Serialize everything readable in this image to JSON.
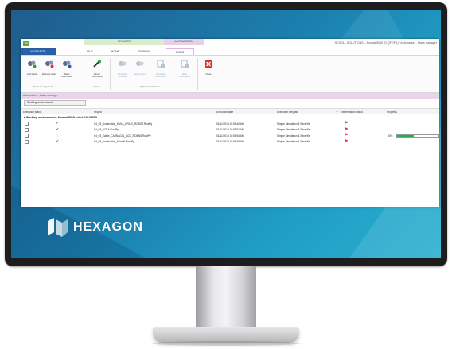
{
  "window": {
    "app_badge": "NC",
    "title": "HCSOLL SOLUTIONS – Nomad 5019 (D:QFOFS) / Automation - Tasks manager",
    "context_project": "PROJECT",
    "context_automation": "AUTOMATION"
  },
  "tabs": {
    "file": "WORKSITE",
    "t1": "FILE",
    "t2": "HOME",
    "t3": "DISPLAY",
    "t4": "ROBO"
  },
  "ribbon": {
    "add_tasks": "Add tasks",
    "remove_tasks": "Remove tasks",
    "tasks_information": "Tasks information",
    "tasks_group": "Tasks management",
    "server_information": "Server information",
    "server_group": "Server",
    "previous_process": "Previous process",
    "next_process": "Next process",
    "previous_information": "Previous information",
    "next_information": "Next information",
    "project_group": "Project informations",
    "close": "Close"
  },
  "breadcrumb": "Automation - tasks manager",
  "toolbar": {
    "env_button": "Working environment"
  },
  "grid": {
    "headers": [
      "Execution status",
      "Project",
      "Execution date",
      "Execution template",
      "Informations status",
      "Progress"
    ],
    "group_label": "Working environment : Nomad 5019 subd D2019R15",
    "rows": [
      {
        "status": "done",
        "project": "S4_03_Automation_KUKA_KR120_ROBOT.RoutPy",
        "date": "01/11/2019 10:55:40 AM",
        "template": "Simple Simulation & Save file",
        "flag": "blue",
        "progress_text": "",
        "progress": 0
      },
      {
        "status": "done",
        "project": "S4_03_ACKA.RoutPy",
        "date": "01/11/2019 10:55:51 AM",
        "template": "Simple Simulation & Save file",
        "flag": "red",
        "progress_text": "",
        "progress": 0
      },
      {
        "status": "pending",
        "project": "S4_03_Gabie_CARNAGIN_ACD_SIDENS.RoutPy",
        "date": "01/11/2019 10:55:54 AM",
        "template": "Simple Simulation & Save file",
        "flag": "red",
        "progress_text": "40%",
        "progress": 0.4
      },
      {
        "status": "done",
        "project": "S4_03_Automation_Stockel.RoutPy",
        "date": "01/11/2019 10:55:45 AM",
        "template": "Simple Simulation & Save file",
        "flag": "red",
        "progress_text": "",
        "progress": 0
      }
    ]
  },
  "brand": {
    "name": "HEXAGON"
  },
  "colors": {
    "accent": "#2a5fa8",
    "ribbon_context": "#e8cfe8",
    "progress": "#22b04e",
    "screen": "#1b7fae"
  }
}
